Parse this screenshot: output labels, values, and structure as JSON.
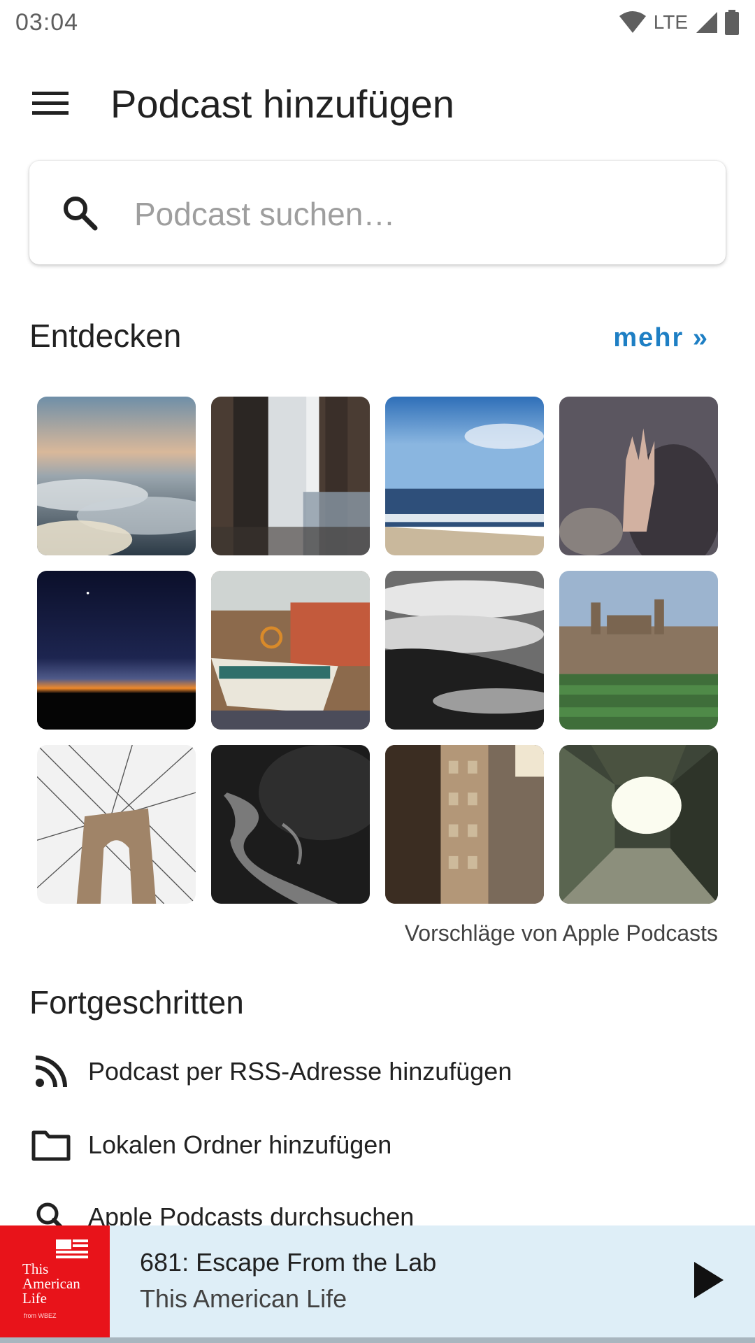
{
  "status_bar": {
    "time": "03:04",
    "network": "LTE"
  },
  "toolbar": {
    "title": "Podcast hinzufügen"
  },
  "search": {
    "placeholder": "Podcast suchen…"
  },
  "discover": {
    "title": "Entdecken",
    "more": "mehr »",
    "tiles": [
      {
        "subject": "clouds at sunset"
      },
      {
        "subject": "window with curtain and chair"
      },
      {
        "subject": "ocean beach"
      },
      {
        "subject": "hand on rainy glass"
      },
      {
        "subject": "night sky horizon"
      },
      {
        "subject": "sailing boats in harbor"
      },
      {
        "subject": "fog over hills"
      },
      {
        "subject": "gothic college building"
      },
      {
        "subject": "suspension bridge cables"
      },
      {
        "subject": "forest road"
      },
      {
        "subject": "city buildings alley"
      },
      {
        "subject": "skyscraper courtyard looking up"
      }
    ],
    "attribution": "Vorschläge von Apple Podcasts"
  },
  "advanced": {
    "title": "Fortgeschritten",
    "items": [
      {
        "label": "Podcast per RSS-Adresse hinzufügen",
        "icon": "rss-icon"
      },
      {
        "label": "Lokalen Ordner hinzufügen",
        "icon": "folder-icon"
      },
      {
        "label": "Apple Podcasts durchsuchen",
        "icon": "search-icon"
      }
    ]
  },
  "player": {
    "episode_title": "681: Escape From the Lab",
    "podcast_name": "This American Life",
    "art_lines": [
      "This",
      "American",
      "Life"
    ],
    "art_small": "from WBEZ",
    "art_color": "#e8131a"
  },
  "colors": {
    "accent": "#1e7fc4",
    "player_bg": "#deeef7"
  }
}
